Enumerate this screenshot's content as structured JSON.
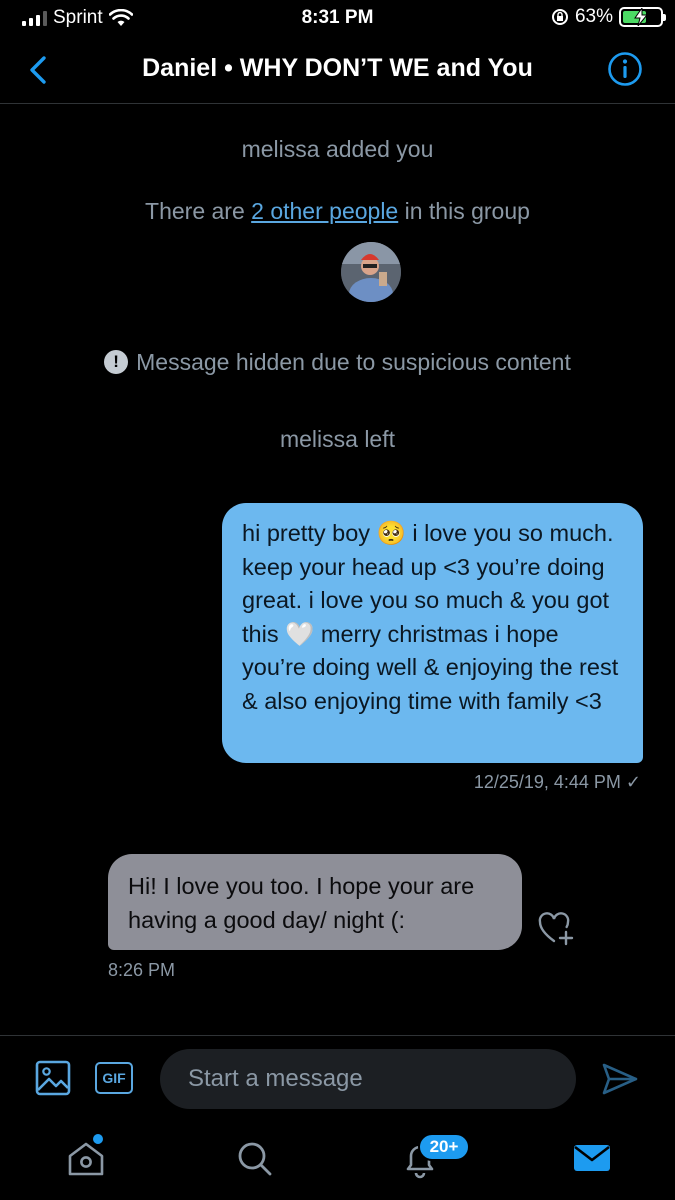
{
  "status_bar": {
    "carrier": "Sprint",
    "time": "8:31 PM",
    "battery_percent": "63%",
    "battery_level": 0.63
  },
  "header": {
    "title": "Daniel • WHY DON’T WE and You"
  },
  "conversation": {
    "added_notice": "melissa added you",
    "people_prefix": "There are ",
    "people_link": "2 other people",
    "people_suffix": " in this group",
    "hidden_notice": "Message hidden due to suspicious content",
    "left_notice": "melissa left",
    "outgoing": {
      "text_1": "hi pretty boy ",
      "emoji_1": "🥺",
      "text_2": " i love you so much. keep your head up <3 you’re doing great. i love you so much & you got this ",
      "emoji_2": "🤍",
      "text_3": " merry christmas i hope you’re doing well & enjoying the rest & also enjoying time with family <3",
      "timestamp": "12/25/19, 4:44 PM ✓"
    },
    "incoming": {
      "text": "Hi! I love you too. I hope your are having a good day/ night (:",
      "timestamp": "8:26 PM"
    }
  },
  "composer": {
    "gif_label": "GIF",
    "placeholder": "Start a message"
  },
  "tabbar": {
    "notifications_badge": "20+"
  },
  "colors": {
    "accent": "#1d9bf0",
    "outgoing_bubble": "#6cb8ef",
    "incoming_bubble": "#8e8f98",
    "secondary_text": "#8b98a5"
  }
}
